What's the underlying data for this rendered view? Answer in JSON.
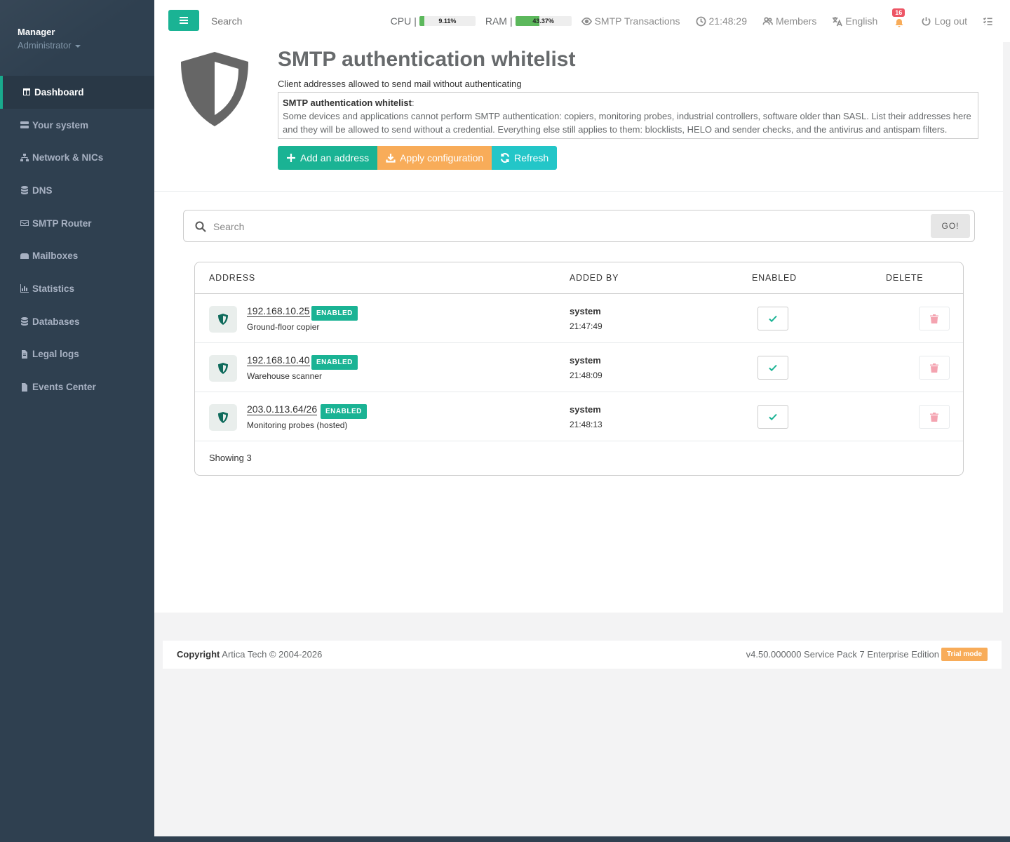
{
  "profile": {
    "name": "Manager",
    "role": "Administrator"
  },
  "nav": [
    {
      "label": "Dashboard",
      "icon": "table-icon"
    },
    {
      "label": "Your system",
      "icon": "server-icon"
    },
    {
      "label": "Network & NICs",
      "icon": "sitemap-icon"
    },
    {
      "label": "DNS",
      "icon": "database-icon"
    },
    {
      "label": "SMTP Router",
      "icon": "envelope-icon"
    },
    {
      "label": "Mailboxes",
      "icon": "mailbox-icon"
    },
    {
      "label": "Statistics",
      "icon": "bar-chart-icon"
    },
    {
      "label": "Databases",
      "icon": "database-icon"
    },
    {
      "label": "Legal logs",
      "icon": "file-icon"
    },
    {
      "label": "Events Center",
      "icon": "file-text-icon"
    }
  ],
  "topbar": {
    "search_placeholder": "Search",
    "cpu_label": "CPU",
    "cpu_value": "9.11%",
    "cpu_percent": 9.11,
    "ram_label": "RAM",
    "ram_value": "43.37%",
    "ram_percent": 43.37,
    "separator": "|",
    "smtp_transactions": "SMTP Transactions",
    "clock": "21:48:29",
    "members": "Members",
    "language": "English",
    "notifications_count": "16",
    "logout": "Log out"
  },
  "header": {
    "title": "SMTP authentication whitelist",
    "subtitle": "Client addresses allowed to send mail without authenticating",
    "explain_title": "SMTP authentication whitelist",
    "explain_body": "Some devices and applications cannot perform SMTP authentication: copiers, monitoring probes, industrial controllers, software older than SASL. List their addresses here and they will be allowed to send without a credential. Everything else still applies to them: blocklists, HELO and sender checks, and the antivirus and antispam filters."
  },
  "buttons": {
    "add": "Add an address",
    "apply": "Apply configuration",
    "refresh": "Refresh"
  },
  "search": {
    "placeholder": "Search",
    "go": "GO!"
  },
  "table": {
    "columns": [
      "ADDRESS",
      "ADDED BY",
      "ENABLED",
      "DELETE"
    ],
    "rows": [
      {
        "address": "192.168.10.25",
        "status": "ENABLED",
        "description": "Ground-floor copier",
        "added_by": "system",
        "time": "21:47:49",
        "enabled": true
      },
      {
        "address": "192.168.10.40",
        "status": "ENABLED",
        "description": "Warehouse scanner",
        "added_by": "system",
        "time": "21:48:09",
        "enabled": true
      },
      {
        "address": "203.0.113.64/26",
        "status": "ENABLED",
        "description": "Monitoring probes (hosted)",
        "added_by": "system",
        "time": "21:48:13",
        "enabled": true
      }
    ],
    "footer": "Showing 3"
  },
  "footer": {
    "copyright_label": "Copyright",
    "copyright_text": "Artica Tech © 2004-2026",
    "version": "v4.50.000000 Service Pack 7 Enterprise Edition",
    "trial": "Trial mode"
  },
  "colors": {
    "accent": "#1ab394",
    "warning": "#f8ac59",
    "info": "#23c6c8",
    "sidebar": "#2f4050",
    "danger": "#ed5565"
  }
}
